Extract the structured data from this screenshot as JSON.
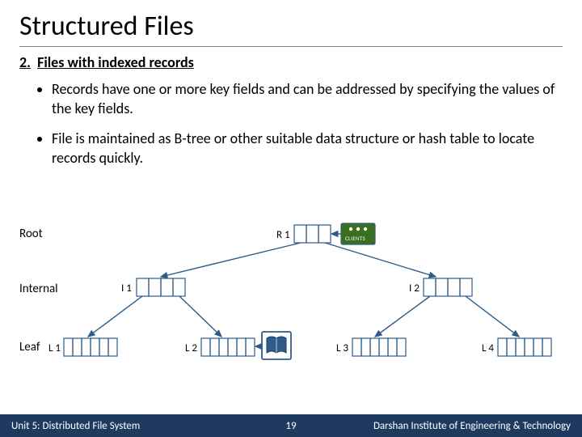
{
  "title": "Structured Files",
  "subhead_number": "2.",
  "subhead_text": "Files with indexed records",
  "bullets": [
    "Records have one or more key fields and can be addressed by specifying the values of the key fields.",
    "File is maintained as B-tree or other suitable data structure or hash table to locate records quickly."
  ],
  "labels": {
    "root": "Root",
    "internal": "Internal",
    "leaf": "Leaf"
  },
  "nodes": {
    "r1": "R 1",
    "i1": "I 1",
    "i2": "I 2",
    "l1": "L 1",
    "l2": "L 2",
    "l3": "L 3",
    "l4": "L 4",
    "client": "CLIENTS"
  },
  "footer": {
    "left": "Unit 5: Distributed File System",
    "page": "19",
    "right": "Darshan Institute of Engineering & Technology"
  },
  "chart_data": {
    "type": "diagram",
    "structure": "B-tree",
    "levels": [
      {
        "name": "Root",
        "nodes": [
          "R 1"
        ]
      },
      {
        "name": "Internal",
        "nodes": [
          "I 1",
          "I 2"
        ]
      },
      {
        "name": "Leaf",
        "nodes": [
          "L 1",
          "L 2",
          "L 3",
          "L 4"
        ]
      }
    ],
    "edges": [
      [
        "R 1",
        "I 1"
      ],
      [
        "R 1",
        "I 2"
      ],
      [
        "I 1",
        "L 1"
      ],
      [
        "I 1",
        "L 2"
      ],
      [
        "I 2",
        "L 3"
      ],
      [
        "I 2",
        "L 4"
      ]
    ],
    "root_attached": "CLIENTS",
    "leaf_access_icon_on": "L 2"
  }
}
